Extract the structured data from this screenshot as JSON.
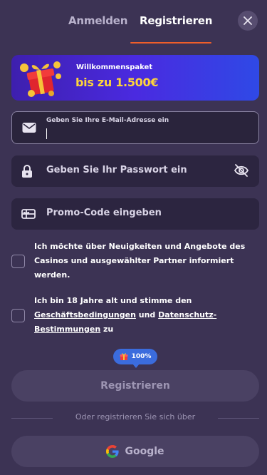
{
  "tabs": {
    "login": "Anmelden",
    "register": "Registrieren",
    "active": "register"
  },
  "banner": {
    "subtitle": "Willkommenspaket",
    "headline": "bis zu 1.500€"
  },
  "email": {
    "label": "Geben Sie Ihre E-Mail-Adresse ein",
    "value": "",
    "icon": "envelope-icon"
  },
  "password": {
    "placeholder": "Geben Sie Ihr Passwort ein",
    "icon": "lock-icon",
    "toggle_icon": "eye-off-icon"
  },
  "promo": {
    "placeholder": "Promo-Code eingeben",
    "icon": "gift-card-icon"
  },
  "checkboxes": {
    "newsletter": "Ich möchte über Neuigkeiten und Angebote des Casinos und ausgewählter Partner informiert werden.",
    "terms_prefix": "Ich bin 18 Jahre alt und stimme den",
    "terms_link": "Geschäftsbedingungen",
    "terms_and": "und",
    "privacy_link": "Datenschutz-Bestimmungen",
    "terms_suffix": "zu"
  },
  "progress_badge": {
    "text": "100%",
    "value": 100
  },
  "register_button": "Registrieren",
  "divider_text": "Oder registrieren Sie sich über",
  "google_button": "Google",
  "colors": {
    "background": "#3c3354",
    "accent": "#ef5e2a",
    "badge": "#3b6cdd",
    "banner_highlight": "#ffd53a"
  }
}
